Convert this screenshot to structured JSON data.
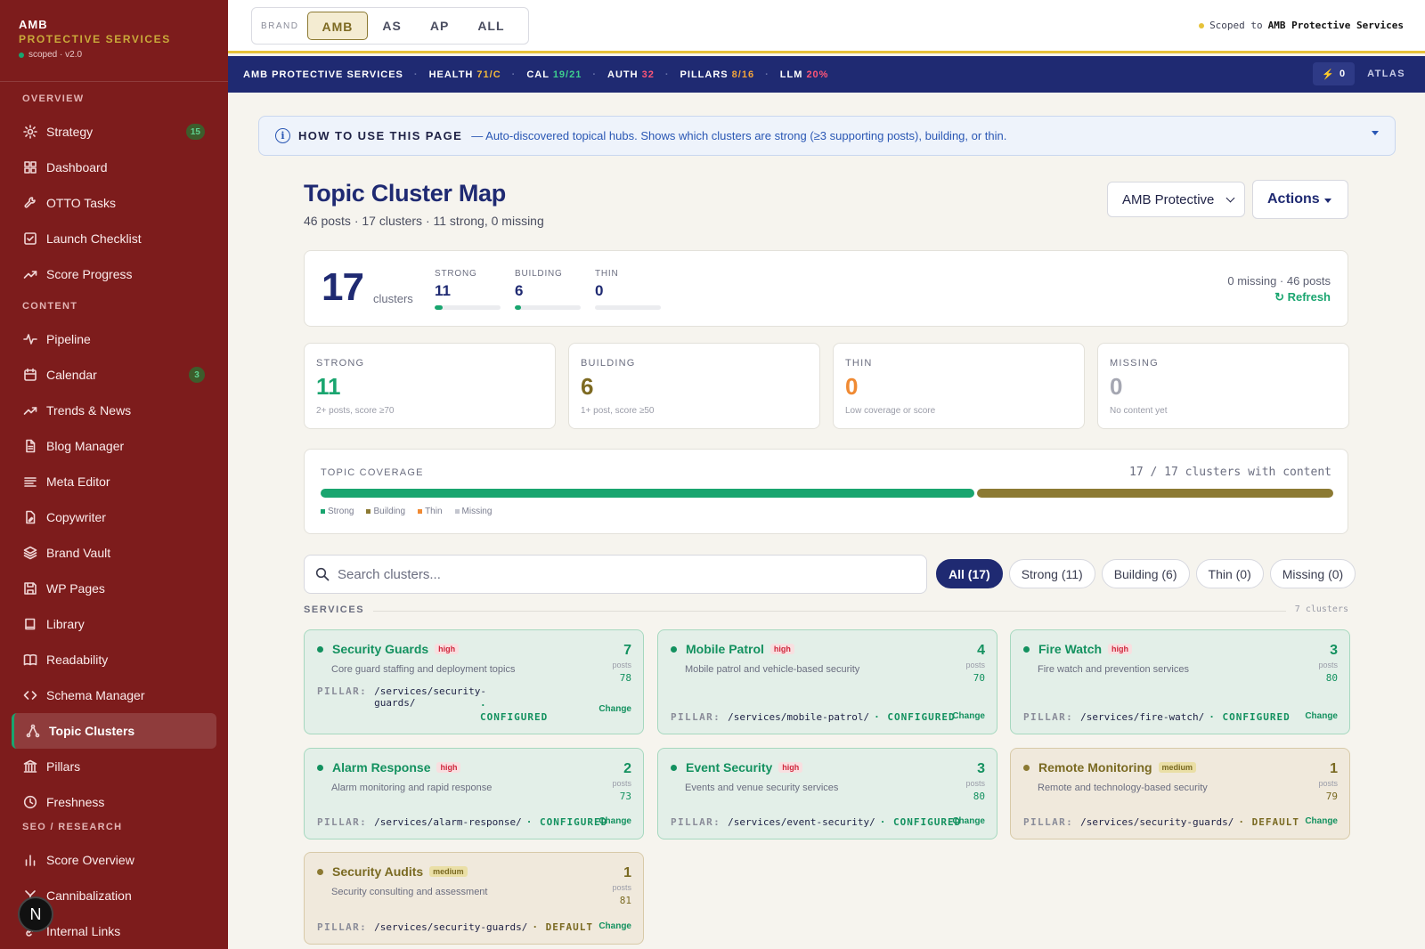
{
  "brand": {
    "line1": "AMB",
    "line2": "PROTECTIVE SERVICES",
    "line3": "scoped · v2.0"
  },
  "sidebar": {
    "sections": [
      {
        "title": "OVERVIEW",
        "items": [
          {
            "label": "Strategy",
            "icon": "sparkle-icon",
            "badge": "15"
          },
          {
            "label": "Dashboard",
            "icon": "grid-icon"
          },
          {
            "label": "OTTO Tasks",
            "icon": "wrench-icon"
          },
          {
            "label": "Launch Checklist",
            "icon": "checklist-icon"
          },
          {
            "label": "Score Progress",
            "icon": "trend-icon"
          }
        ]
      },
      {
        "title": "CONTENT",
        "items": [
          {
            "label": "Pipeline",
            "icon": "pulse-icon"
          },
          {
            "label": "Calendar",
            "icon": "calendar-icon",
            "badge": "3"
          },
          {
            "label": "Trends & News",
            "icon": "trend-icon"
          },
          {
            "label": "Blog Manager",
            "icon": "document-icon"
          },
          {
            "label": "Meta Editor",
            "icon": "lines-icon"
          },
          {
            "label": "Copywriter",
            "icon": "document-edit-icon"
          },
          {
            "label": "Brand Vault",
            "icon": "layers-icon"
          },
          {
            "label": "WP Pages",
            "icon": "save-icon"
          },
          {
            "label": "Library",
            "icon": "book-icon"
          },
          {
            "label": "Readability",
            "icon": "open-book-icon"
          },
          {
            "label": "Schema Manager",
            "icon": "code-icon"
          },
          {
            "label": "Topic Clusters",
            "icon": "network-icon",
            "active": true
          },
          {
            "label": "Pillars",
            "icon": "pillar-icon"
          },
          {
            "label": "Freshness",
            "icon": "clock-icon"
          }
        ]
      },
      {
        "title": "SEO / RESEARCH",
        "items": [
          {
            "label": "Score Overview",
            "icon": "bar-chart-icon"
          },
          {
            "label": "Cannibalization",
            "icon": "split-icon"
          },
          {
            "label": "Internal Links",
            "icon": "link-icon"
          }
        ]
      }
    ],
    "avatar": "N"
  },
  "topbar": {
    "brand_label": "BRAND",
    "options": [
      "AMB",
      "AS",
      "AP",
      "ALL"
    ],
    "selected": "AMB",
    "scoped_prefix": "Scoped to",
    "scoped_name": "AMB Protective Services"
  },
  "statusbar": {
    "company": "AMB PROTECTIVE SERVICES",
    "items": [
      {
        "label": "HEALTH",
        "value": "71/C",
        "color": "#f2b93b"
      },
      {
        "label": "CAL",
        "value": "19/21",
        "color": "#3ecf8e"
      },
      {
        "label": "AUTH",
        "value": "32",
        "color": "#ff5577"
      },
      {
        "label": "PILLARS",
        "value": "8/16",
        "color": "#f2a43b"
      },
      {
        "label": "LLM",
        "value": "20%",
        "color": "#ff5577"
      }
    ],
    "bolt_count": "0",
    "atlas": "ATLAS"
  },
  "banner": {
    "title": "HOW TO USE THIS PAGE",
    "text": "— Auto-discovered topical hubs. Shows which clusters are strong (≥3 supporting posts), building, or thin."
  },
  "page": {
    "title": "Topic Cluster Map",
    "subtitle": "46 posts · 17 clusters · 11 strong, 0 missing",
    "select_value": "AMB Protective",
    "actions_label": "Actions"
  },
  "summary": {
    "total": "17",
    "total_label": "clusters",
    "minis": [
      {
        "label": "STRONG",
        "value": "11",
        "fill": 0.12
      },
      {
        "label": "BUILDING",
        "value": "6",
        "fill": 0.06
      },
      {
        "label": "THIN",
        "value": "0",
        "fill": 0
      }
    ],
    "right_text": "0 missing · 46 posts",
    "refresh": "↻ Refresh"
  },
  "stats": [
    {
      "label": "STRONG",
      "value": "11",
      "desc": "2+ posts, score ≥70",
      "color": "#19a56f"
    },
    {
      "label": "BUILDING",
      "value": "6",
      "desc": "1+ post, score ≥50",
      "color": "#7d6a22"
    },
    {
      "label": "THIN",
      "value": "0",
      "desc": "Low coverage or score",
      "color": "#f08a33"
    },
    {
      "label": "MISSING",
      "value": "0",
      "desc": "No content yet",
      "color": "#a5a7b2"
    }
  ],
  "coverage": {
    "label": "TOPIC COVERAGE",
    "right": "17 / 17 clusters with content",
    "segments": [
      {
        "name": "Strong",
        "count": 11,
        "color": "#19a56f"
      },
      {
        "name": "Building",
        "count": 6,
        "color": "#8c7a33"
      },
      {
        "name": "Thin",
        "count": 0,
        "color": "#f08a33"
      },
      {
        "name": "Missing",
        "count": 0,
        "color": "#c4c6cf"
      }
    ]
  },
  "search": {
    "placeholder": "Search clusters..."
  },
  "filters": [
    "All (17)",
    "Strong (11)",
    "Building (6)",
    "Thin (0)",
    "Missing (0)"
  ],
  "group": {
    "label": "SERVICES",
    "count": "7 clusters"
  },
  "pillar_key": "PILLAR:",
  "change_label": "Change",
  "posts_label": "posts",
  "clusters": [
    {
      "name": "Security Guards",
      "priority": "high",
      "desc": "Core guard staffing and deployment topics",
      "posts": "7",
      "score": "78",
      "path": "/services/security-guards/",
      "status": "· CONFIGURED",
      "tier": "strong"
    },
    {
      "name": "Mobile Patrol",
      "priority": "high",
      "desc": "Mobile patrol and vehicle-based security",
      "posts": "4",
      "score": "70",
      "path": "/services/mobile-patrol/",
      "status": "· CONFIGURED",
      "tier": "strong"
    },
    {
      "name": "Fire Watch",
      "priority": "high",
      "desc": "Fire watch and prevention services",
      "posts": "3",
      "score": "80",
      "path": "/services/fire-watch/",
      "status": "· CONFIGURED",
      "tier": "strong"
    },
    {
      "name": "Alarm Response",
      "priority": "high",
      "desc": "Alarm monitoring and rapid response",
      "posts": "2",
      "score": "73",
      "path": "/services/alarm-response/",
      "status": "· CONFIGURED",
      "tier": "strong"
    },
    {
      "name": "Event Security",
      "priority": "high",
      "desc": "Events and venue security services",
      "posts": "3",
      "score": "80",
      "path": "/services/event-security/",
      "status": "· CONFIGURED",
      "tier": "strong"
    },
    {
      "name": "Remote Monitoring",
      "priority": "medium",
      "desc": "Remote and technology-based security",
      "posts": "1",
      "score": "79",
      "path": "/services/security-guards/",
      "status": "· DEFAULT",
      "tier": "building"
    },
    {
      "name": "Security Audits",
      "priority": "medium",
      "desc": "Security consulting and assessment",
      "posts": "1",
      "score": "81",
      "path": "/services/security-guards/",
      "status": "· DEFAULT",
      "tier": "building"
    }
  ]
}
